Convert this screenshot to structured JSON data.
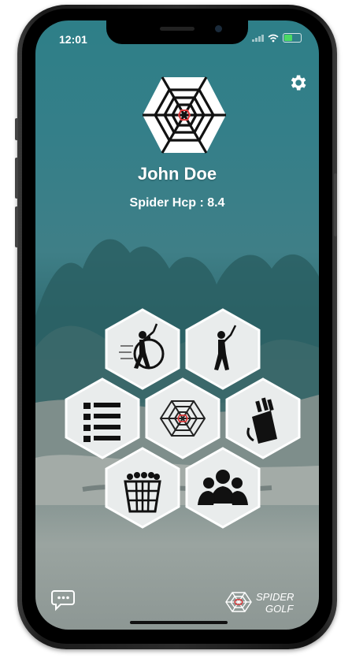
{
  "status": {
    "time": "12:01"
  },
  "profile": {
    "name": "John Doe",
    "handicap": "Spider Hcp : 8.4"
  },
  "menu": [
    {
      "name": "swing-speed-icon"
    },
    {
      "name": "golfer-swing-icon"
    },
    {
      "name": "list-icon"
    },
    {
      "name": "spider-web-icon"
    },
    {
      "name": "golf-bag-icon"
    },
    {
      "name": "ball-basket-icon"
    },
    {
      "name": "group-icon"
    }
  ],
  "brand": {
    "line1": "SPIDER",
    "line2": "GOLF"
  },
  "colors": {
    "accent": "#d9383a",
    "teal": "#2e7f88",
    "hex_fill": "#e9ecec"
  }
}
